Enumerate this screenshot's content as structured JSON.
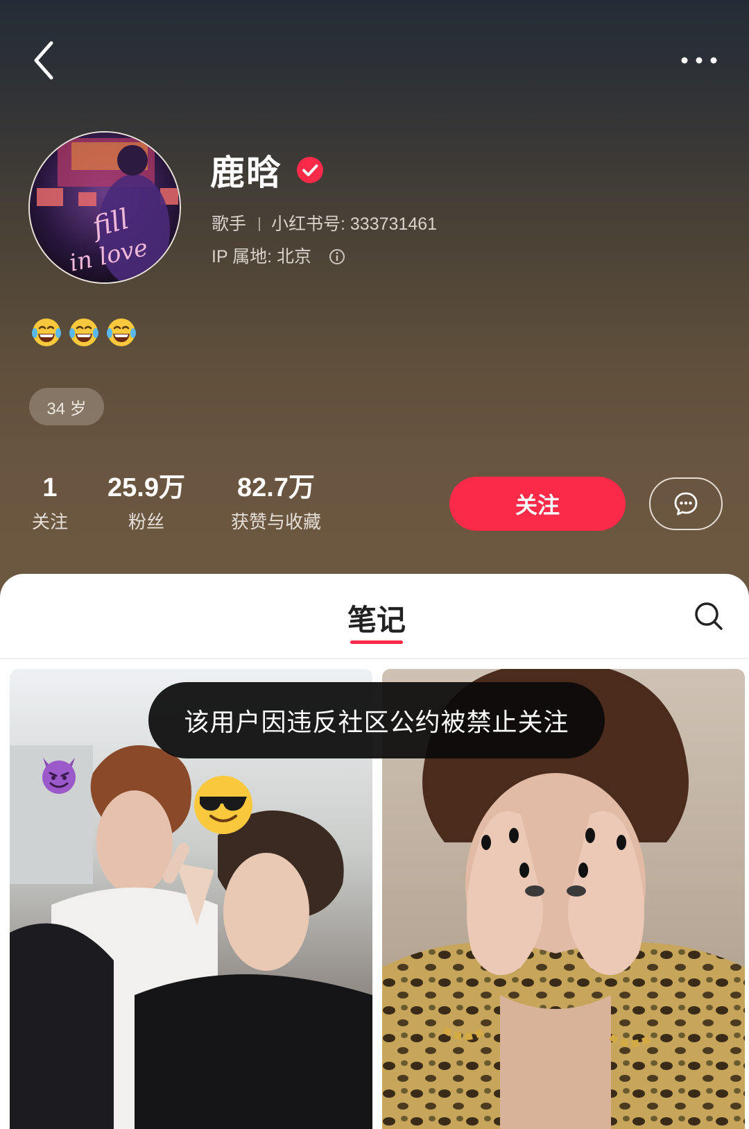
{
  "header": {
    "back_icon": "chevron-left-icon",
    "more_icon": "more-horizontal-icon"
  },
  "profile": {
    "name": "鹿晗",
    "verified_icon": "verified-check-icon",
    "occupation": "歌手",
    "account_id_label": "小红书号: 333731461",
    "ip_location": "IP 属地: 北京",
    "bio": [
      "😂",
      "😂",
      "😂"
    ],
    "age_tag": "34 岁"
  },
  "stats": [
    {
      "value": "1",
      "label": "关注"
    },
    {
      "value": "25.9万",
      "label": "粉丝"
    },
    {
      "value": "82.7万",
      "label": "获赞与收藏"
    }
  ],
  "actions": {
    "follow_label": "关注",
    "message_icon": "chat-bubble-icon"
  },
  "tabs": {
    "notes_label": "笔记",
    "search_icon": "search-icon"
  },
  "toast": {
    "message": "该用户因违反社区公约被禁止关注"
  },
  "colors": {
    "accent": "#fb2a48",
    "header_top": "#232c36",
    "header_bottom": "#6d5841"
  }
}
